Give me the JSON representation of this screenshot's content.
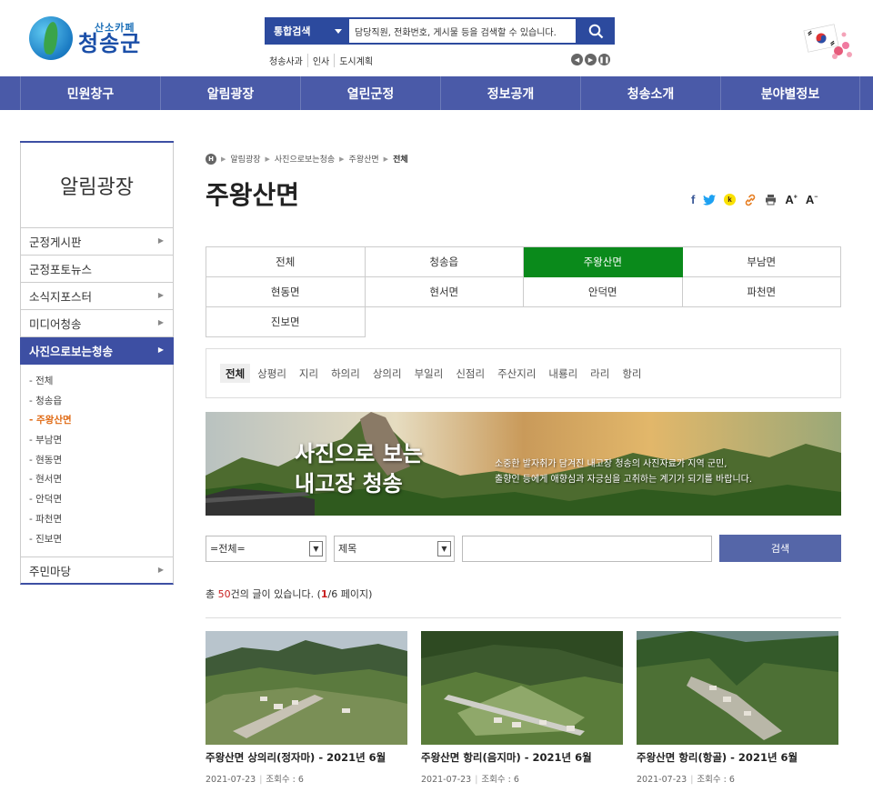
{
  "header": {
    "logo_sub": "산소카페",
    "logo_main": "청송군",
    "search_category": "통합검색",
    "search_placeholder": "담당직원, 전화번호, 게시물 등을 검색할 수 있습니다.",
    "quick_links": [
      "청송사과",
      "인사",
      "도시계획"
    ]
  },
  "gnb": [
    "민원창구",
    "알림광장",
    "열린군정",
    "정보공개",
    "청송소개",
    "분야별정보"
  ],
  "lnb": {
    "title": "알림광장",
    "items_before": [
      "군정게시판",
      "군정포토뉴스",
      "소식지포스터",
      "미디어청송"
    ],
    "items_before_arrow": [
      true,
      false,
      true,
      true
    ],
    "active": "사진으로보는청송",
    "sub": [
      "- 전체",
      "- 청송읍",
      "- 주왕산면",
      "- 부남면",
      "- 현동면",
      "- 현서면",
      "- 안덕면",
      "- 파천면",
      "- 진보면"
    ],
    "sub_active_index": 2,
    "items_after": [
      "주민마당"
    ]
  },
  "breadcrumb": [
    "알림광장",
    "사진으로보는청송",
    "주왕산면",
    "전체"
  ],
  "page_title": "주왕산면",
  "sns": [
    "f",
    "t",
    "k",
    "link",
    "print",
    "A+",
    "A-"
  ],
  "tabs": [
    "전체",
    "청송읍",
    "주왕산면",
    "부남면",
    "현동면",
    "현서면",
    "안덕면",
    "파천면",
    "진보면"
  ],
  "tab_active_index": 2,
  "villages": [
    "전체",
    "상평리",
    "지리",
    "하의리",
    "상의리",
    "부일리",
    "신점리",
    "주산지리",
    "내룡리",
    "라리",
    "항리"
  ],
  "village_active_index": 0,
  "banner": {
    "title_line1": "사진으로 보는",
    "title_line2": "내고장 청송",
    "desc_line1": "소중한 발자취가 담겨진 내고장 청송의 사진자료가 지역 군민,",
    "desc_line2": "출향인 등에게 애향심과 자긍심을 고취하는 계기가 되기를 바랍니다."
  },
  "search": {
    "select1": "=전체=",
    "select2": "제목",
    "query": "",
    "button": "검색"
  },
  "count": {
    "prefix": "총 ",
    "total": "50",
    "mid": "건의 글이 있습니다. (",
    "page": "1",
    "suffix": "/6 페이지)"
  },
  "gallery": [
    {
      "title": "주왕산면 상의리(정자마) - 2021년 6월",
      "date": "2021-07-23",
      "views": "조회수 : 6"
    },
    {
      "title": "주왕산면 항리(음지마) - 2021년 6월",
      "date": "2021-07-23",
      "views": "조회수 : 6"
    },
    {
      "title": "주왕산면 항리(항골) - 2021년 6월",
      "date": "2021-07-23",
      "views": "조회수 : 6"
    }
  ]
}
